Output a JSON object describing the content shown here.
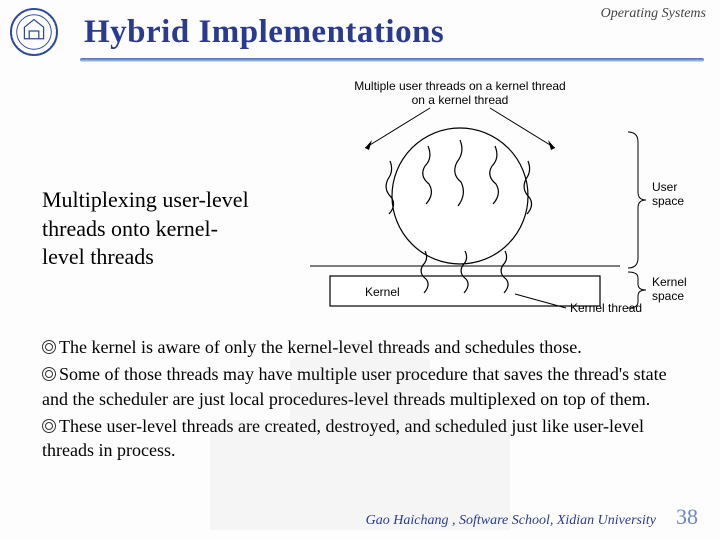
{
  "header": {
    "tag": "Operating Systems",
    "title": "Hybrid Implementations"
  },
  "caption": "Multiplexing user-level threads onto kernel- level threads",
  "diagram": {
    "top_label": "Multiple user threads on a kernel thread",
    "kernel_label": "Kernel",
    "kernel_thread_label": "Kernel thread",
    "user_space_label": "User space",
    "kernel_space_label": "Kernel space"
  },
  "points": [
    "The kernel is aware of only the kernel-level threads and schedules those.",
    "Some of those threads may have multiple user procedure that saves the thread's state and the scheduler are just local procedures-level threads multiplexed on top of them.",
    "These user-level threads are created, destroyed, and scheduled just like user-level threads in process."
  ],
  "footer": {
    "author": "Gao Haichang , Software School, Xidian University",
    "page": "38"
  }
}
